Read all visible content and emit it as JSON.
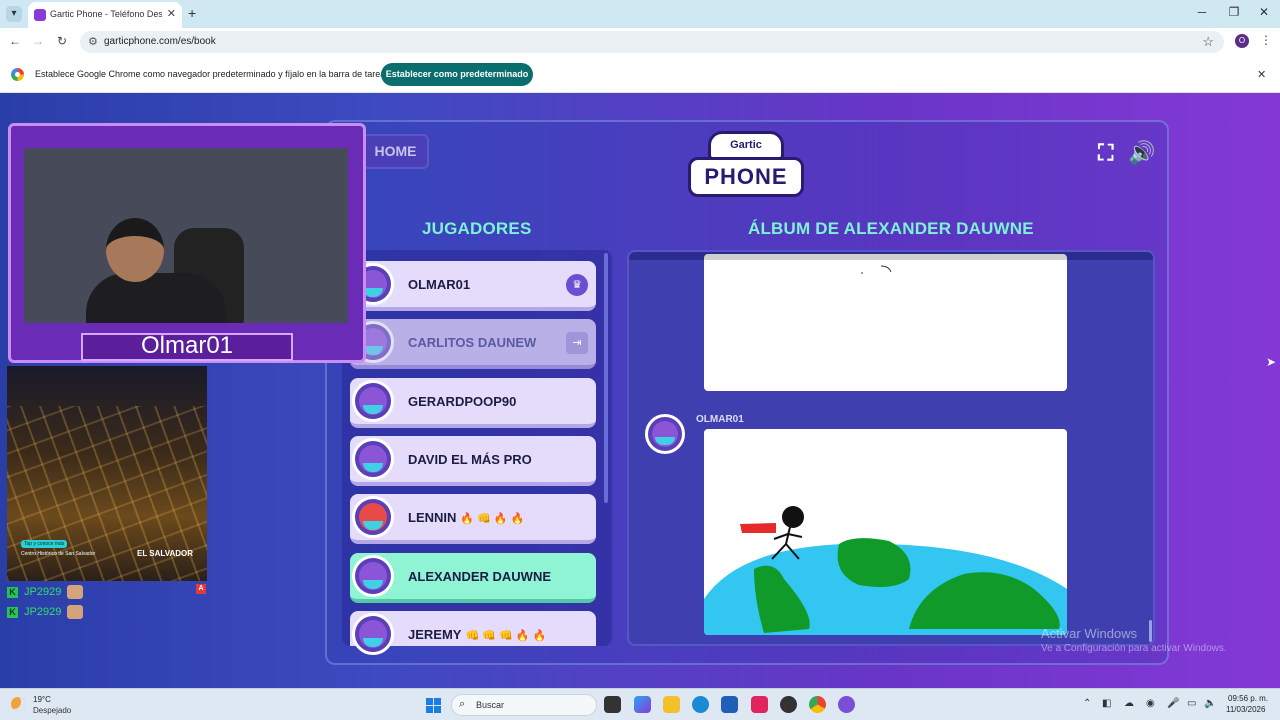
{
  "browser": {
    "tab_title": "Gartic Phone - Teléfono Descon",
    "url": "garticphone.com/es/book",
    "infobar_text": "Establece Google Chrome como navegador predeterminado y fíjalo en la barra de tareas",
    "infobar_button": "Establecer como predeterminado",
    "profile_initial": "O"
  },
  "game": {
    "home_label": "HOME",
    "logo_top": "Gartic",
    "logo_main": "PHONE",
    "players_heading": "JUGADORES",
    "album_heading": "ÁLBUM DE ALEXANDER DAUWNE",
    "players": [
      {
        "name": "OLMAR01",
        "badge": "♛"
      },
      {
        "name": "CARLITOS DAUNEW",
        "badge": "⇥"
      },
      {
        "name": "GERARDPOOP90"
      },
      {
        "name": "DAVID EL MÁS PRO"
      },
      {
        "name": "LENNIN",
        "emojis": "🔥 👊 🔥 🔥"
      },
      {
        "name": "ALEXANDER DAUWNE"
      },
      {
        "name": "JEREMY",
        "emojis": "👊 👊 👊 🔥 🔥"
      }
    ],
    "album_author": "OLMAR01"
  },
  "overlay": {
    "cam_name": "Olmar01",
    "photo_tag": "Tap y conoce más",
    "photo_caption": "Centro Histórico de San Salvador",
    "photo_brand": "EL SALVADOR",
    "ad_badge": "A",
    "chat": [
      {
        "user": "JP2929"
      },
      {
        "user": "JP2929"
      }
    ]
  },
  "watermark": {
    "line1": "Activar Windows",
    "line2": "Ve a Configuración para activar Windows."
  },
  "taskbar": {
    "temp": "19°C",
    "weather": "Despejado",
    "search_placeholder": "Buscar",
    "time": "09:56 p. m.",
    "date": "11/03/2026"
  },
  "colors": {
    "accent_teal": "#7df3d6",
    "active_player": "#8ff4d4",
    "infobar_button": "#0b6e6e"
  }
}
